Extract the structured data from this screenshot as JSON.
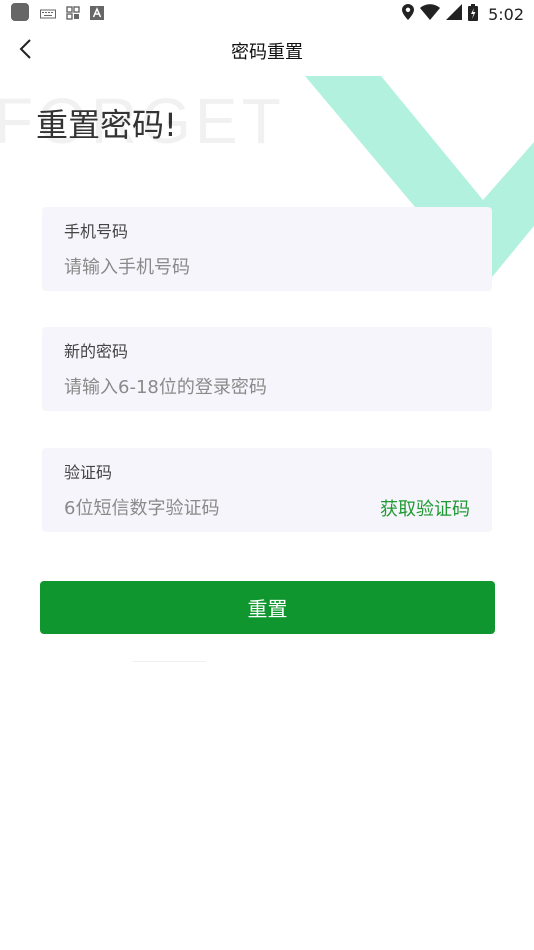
{
  "status_bar": {
    "time": "5:02",
    "left_icons": [
      "app-icon",
      "keyboard-icon",
      "grid-icon",
      "a-icon"
    ],
    "right_icons": [
      "location-icon",
      "wifi-icon",
      "signal-icon",
      "battery-icon"
    ]
  },
  "header": {
    "title": "密码重置",
    "back_icon": "chevron-left-icon"
  },
  "decoration": {
    "background_word": "FORGET",
    "check_color": "#b2f1dd"
  },
  "heading": "重置密码!",
  "form": {
    "phone": {
      "label": "手机号码",
      "placeholder": "请输入手机号码",
      "value": ""
    },
    "password": {
      "label": "新的密码",
      "placeholder": "请输入6-18位的登录密码",
      "value": ""
    },
    "code": {
      "label": "验证码",
      "placeholder": "6位短信数字验证码",
      "value": "",
      "get_code_label": "获取验证码"
    }
  },
  "submit_label": "重置",
  "colors": {
    "accent": "#0f962f",
    "link": "#1f9a32",
    "card_bg": "#f6f5fb"
  }
}
